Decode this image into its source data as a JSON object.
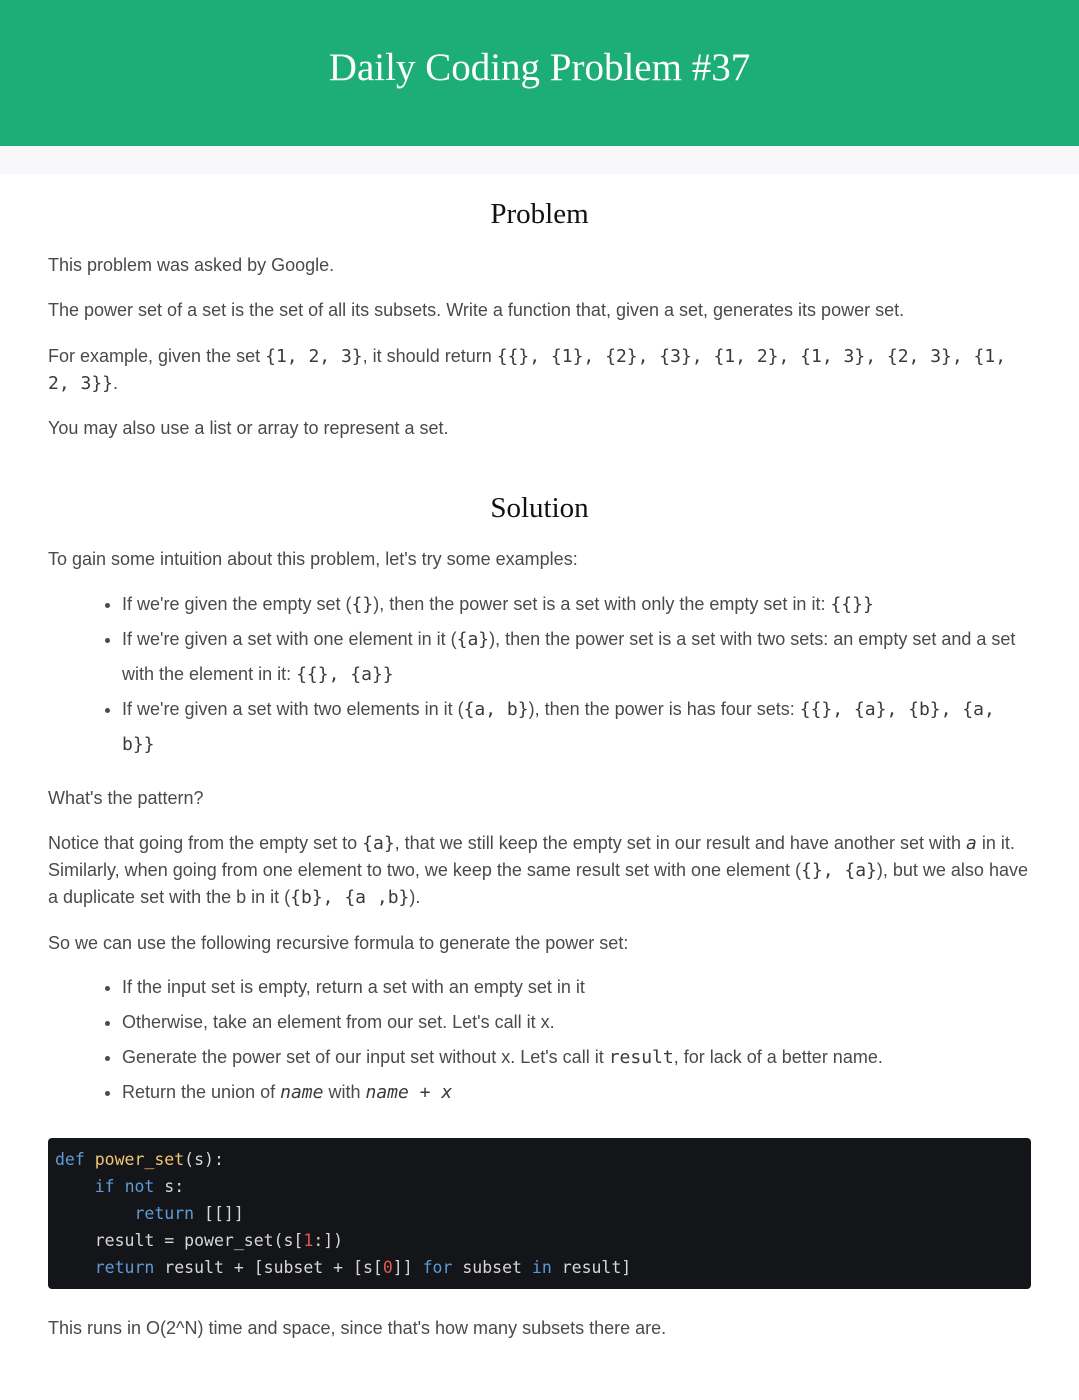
{
  "header": {
    "title": "Daily Coding Problem #37"
  },
  "problem": {
    "heading": "Problem",
    "asked_by": "This problem was asked by Google.",
    "statement": "The power set of a set is the set of all its subsets. Write a function that, given a set, generates its power set.",
    "example_prefix": "For example, given the set ",
    "example_set": "{1, 2, 3}",
    "example_mid": ", it should return ",
    "example_result_line1": "{{}, {1}, {2}, {3}, {1, 2}, {1, 3}, {2, 3}, {1,",
    "example_result_line2": "2, 3}}",
    "example_suffix": ".",
    "note": "You may also use a list or array to represent a set."
  },
  "solution": {
    "heading": "Solution",
    "intro": "To gain some intuition about this problem, let's try some examples:",
    "examples": [
      {
        "t1": "If we're given the empty set (",
        "c1": "{}",
        "t2": "), then the power set is a set with only the empty set in it: ",
        "c2": "{{}}"
      },
      {
        "t1": "If we're given a set with one element in it (",
        "c1": "{a}",
        "t2": "), then the power set is a set with two sets: an empty set and a set with the element in it: ",
        "c2": "{{}, {a}}"
      },
      {
        "t1": "If we're given a set with two elements in it (",
        "c1": "{a, b}",
        "t2": "), then the power is has four sets: ",
        "c2": "{{}, {a}, {b}, {a, b}}"
      }
    ],
    "pattern_q": "What's the pattern?",
    "notice": {
      "t1": "Notice that going from the empty set to ",
      "c1": "{a}",
      "t2": ", that we still keep the empty set in our result and have another set with ",
      "v1": "a",
      "t3": " in it. Similarly, when going from one element to two, we keep the same result set with one element (",
      "c2": "{}, {a}",
      "t4": "), but we also have a duplicate set with the ",
      "v2": "b",
      "t5": " in it (",
      "c3": "{b}, {a ,b}",
      "t6": ")."
    },
    "formula_intro": "So we can use the following recursive formula to generate the power set:",
    "steps": [
      {
        "text": "If the input set is empty, return a set with an empty set in it"
      },
      {
        "text": "Otherwise, take an element from our set. Let's call it x."
      },
      {
        "t1": "Generate the power set of our input set without x. Let's call it ",
        "c1": "result",
        "t2": ", for lack of a better name."
      },
      {
        "t1": "Return the union of ",
        "c1": "name",
        "t2": " with ",
        "c2": "name + x"
      }
    ],
    "code": {
      "l1_kw": "def",
      "l1_fn": "power_set",
      "l1_rest": "(s):",
      "l2_kw1": "if",
      "l2_kw2": "not",
      "l2_rest": " s:",
      "l3_kw": "return",
      "l3_rest": " [[]]",
      "l4_a": "result = power_set(s[",
      "l4_num": "1",
      "l4_b": ":])",
      "l5_kw1": "return",
      "l5_a": " result + [subset + [s[",
      "l5_num": "0",
      "l5_b": "]] ",
      "l5_kw2": "for",
      "l5_c": " subset ",
      "l5_kw3": "in",
      "l5_d": " result]"
    },
    "complexity": "This runs in O(2^N) time and space, since that's how many subsets there are."
  }
}
